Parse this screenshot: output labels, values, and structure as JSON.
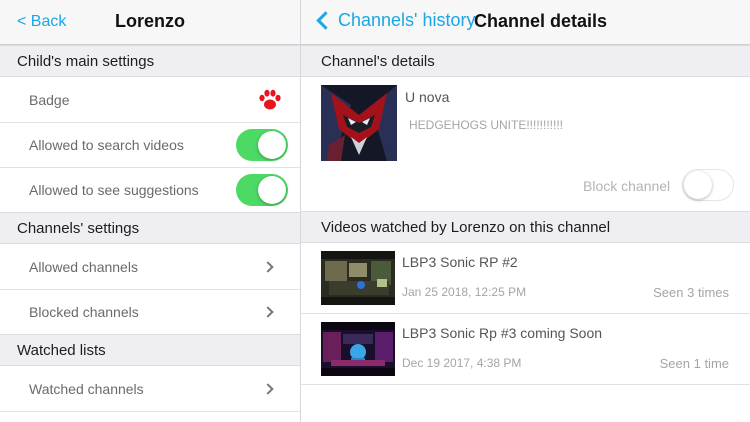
{
  "left_panel": {
    "nav": {
      "back_label": "< Back",
      "title": "Lorenzo"
    },
    "sections": {
      "main_settings": "Child's main settings",
      "channels_settings": "Channels' settings",
      "watched_lists": "Watched lists"
    },
    "rows": {
      "badge": "Badge",
      "allowed_search": "Allowed to search videos",
      "allowed_suggestions": "Allowed to see suggestions",
      "allowed_channels": "Allowed channels",
      "blocked_channels": "Blocked channels",
      "watched_channels": "Watched channels"
    },
    "toggles": {
      "allowed_search": true,
      "allowed_suggestions": true
    },
    "badge_icon": "paw-icon",
    "badge_color": "#e8141e"
  },
  "right_panel": {
    "nav": {
      "back_label": "Channels' history",
      "title": "Channel details"
    },
    "sections": {
      "details": "Channel's details",
      "videos": "Videos watched by Lorenzo on this channel"
    },
    "channel": {
      "name": "U nova",
      "description": "HEDGEHOGS UNITE!!!!!!!!!!!",
      "block_label": "Block channel",
      "blocked": false
    },
    "videos": [
      {
        "title": "LBP3 Sonic RP #2",
        "date": "Jan 25 2018, 12:25 PM",
        "seen": "Seen 3 times"
      },
      {
        "title": "LBP3 Sonic Rp #3 coming Soon",
        "date": "Dec 19 2017, 4:38 PM",
        "seen": "Seen 1 time"
      }
    ]
  },
  "colors": {
    "accent": "#1aa7e6",
    "toggle_on": "#4cd964",
    "section_bg": "#efeff3"
  }
}
